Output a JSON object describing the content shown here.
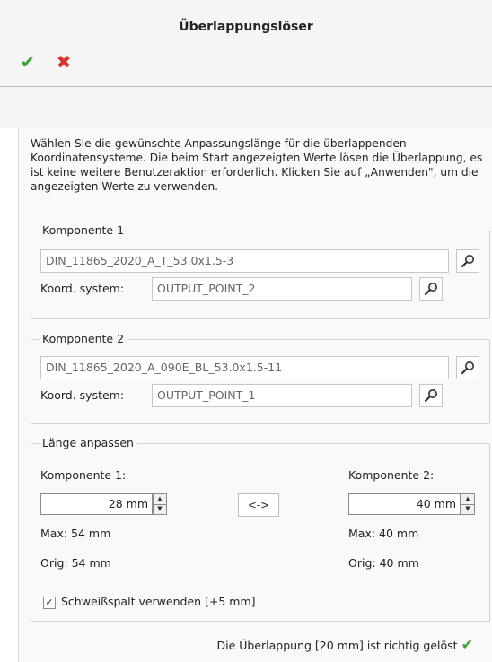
{
  "dialog": {
    "title": "Überlappungslöser",
    "ok_icon": "check-icon",
    "cancel_icon": "close-icon",
    "description": "Wählen Sie die gewünschte Anpassungslänge für die überlappenden Koordinatensysteme. Die beim Start angezeigten Werte lösen die Überlappung, es ist keine weitere Benutzeraktion erforderlich. Klicken Sie auf „Anwenden\", um die angezeigten Werte zu verwenden."
  },
  "komponente1": {
    "legend": "Komponente 1",
    "name": "DIN_11865_2020_A_T_53.0x1.5-3",
    "coord_label": "Koord. system:",
    "coord_value": "OUTPUT_POINT_2"
  },
  "komponente2": {
    "legend": "Komponente 2",
    "name": "DIN_11865_2020_A_090E_BL_53.0x1.5-11",
    "coord_label": "Koord. system:",
    "coord_value": "OUTPUT_POINT_1"
  },
  "laenge": {
    "legend": "Länge anpassen",
    "k1_label": "Komponente 1:",
    "k1_value": "28 mm",
    "k1_max": "Max: 54 mm",
    "k1_orig": "Orig: 54 mm",
    "swap_label": "<->",
    "k2_label": "Komponente 2:",
    "k2_value": "40 mm",
    "k2_max": "Max: 40 mm",
    "k2_orig": "Orig: 40 mm",
    "weld_label": "Schweißspalt verwenden [+5 mm]",
    "weld_checked": true
  },
  "status": {
    "text": "Die Überlappung [20 mm] ist richtig gelöst"
  },
  "colors": {
    "ok": "#3aa43a",
    "cancel": "#d9342b"
  }
}
